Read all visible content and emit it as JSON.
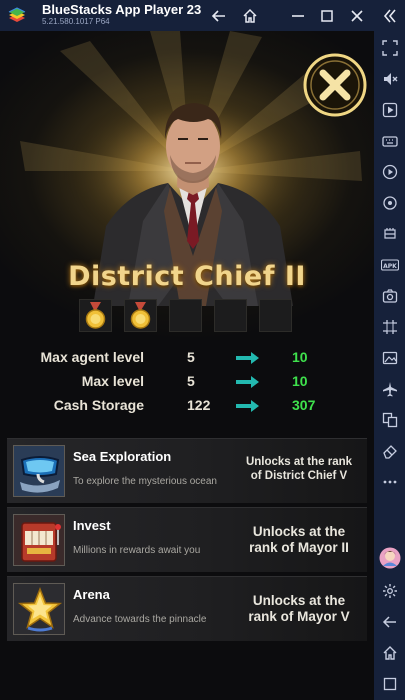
{
  "window": {
    "title": "BlueStacks App Player 23",
    "version": "5.21.580.1017  P64"
  },
  "rank": {
    "title": "District Chief II",
    "medals_earned": 2,
    "medals_total": 5
  },
  "stats": [
    {
      "label": "Max agent level",
      "current": "5",
      "next": "10"
    },
    {
      "label": "Max level",
      "current": "5",
      "next": "10"
    },
    {
      "label": "Cash Storage",
      "current": "122",
      "next": "307"
    }
  ],
  "features": [
    {
      "title": "Sea Exploration",
      "desc": "To explore the mysterious ocean",
      "unlock_line1": "Unlocks at the rank",
      "unlock_line2": "of District Chief V",
      "icon": "diving-mask-icon"
    },
    {
      "title": "Invest",
      "desc": "Millions in rewards await you",
      "unlock_line1": "Unlocks at the",
      "unlock_line2": "rank of Mayor II",
      "icon": "slot-machine-icon"
    },
    {
      "title": "Arena",
      "desc": "Advance towards the pinnacle",
      "unlock_line1": "Unlocks at the",
      "unlock_line2": "rank of Mayor V",
      "icon": "gold-star-icon"
    }
  ],
  "colors": {
    "titlebar": "#16213a",
    "rank_gold": "#f1d58c",
    "upgrade_green": "#3fe24d",
    "arrow_teal": "#23b9b0"
  }
}
